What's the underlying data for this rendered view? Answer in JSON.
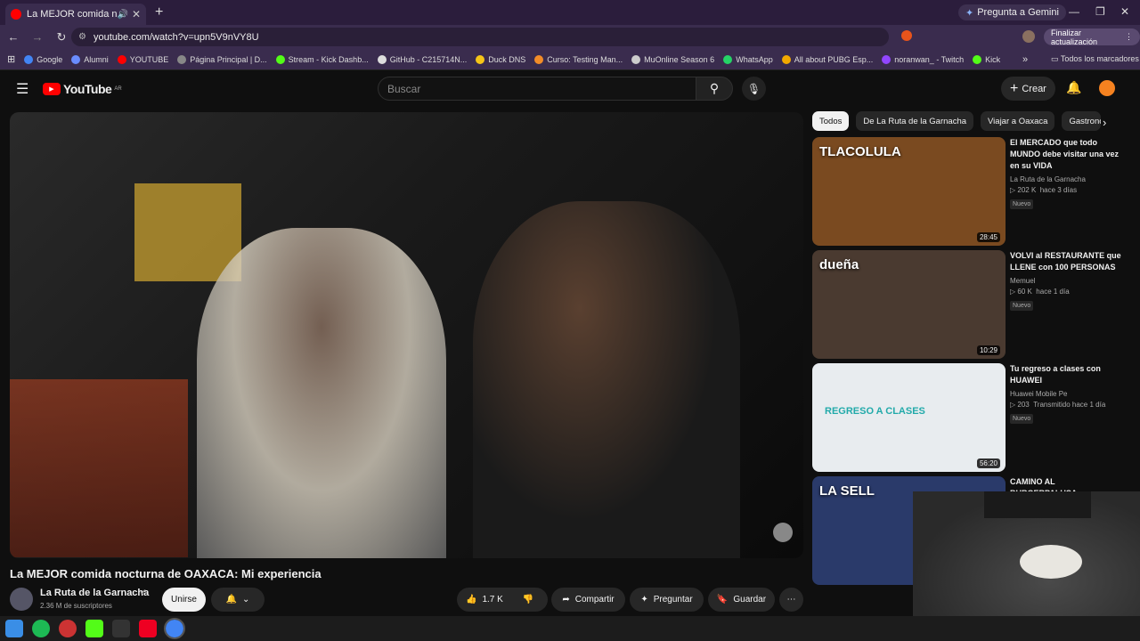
{
  "browser": {
    "tab_title": "La MEJOR comida nocturna",
    "gemini_label": "Pregunta a Gemini",
    "url": "youtube.com/watch?v=upn5V9nVY8U",
    "update_label": "Finalizar actualización",
    "bookmarks": [
      {
        "label": "Google",
        "color": "#4285f4"
      },
      {
        "label": "Alumni",
        "color": "#6a8cff"
      },
      {
        "label": "YOUTUBE",
        "color": "#ff0000"
      },
      {
        "label": "Página Principal | D...",
        "color": "#888888"
      },
      {
        "label": "Stream - Kick Dashb...",
        "color": "#53fc18"
      },
      {
        "label": "GitHub - C215714N...",
        "color": "#dddddd"
      },
      {
        "label": "Duck DNS",
        "color": "#f5c518"
      },
      {
        "label": "Curso: Testing Man...",
        "color": "#f28c28"
      },
      {
        "label": "MuOnline Season 6",
        "color": "#cccccc"
      },
      {
        "label": "WhatsApp",
        "color": "#25d366"
      },
      {
        "label": "All about PUBG Esp...",
        "color": "#f2a900"
      },
      {
        "label": "noranwan_ - Twitch",
        "color": "#9146ff"
      },
      {
        "label": "Kick",
        "color": "#53fc18"
      }
    ],
    "all_bookmarks": "Todos los marcadores"
  },
  "youtube": {
    "logo_text": "YouTube",
    "region": "AR",
    "search_placeholder": "Buscar",
    "create_label": "Crear",
    "video_title": "La MEJOR comida nocturna de OAXACA: Mi experiencia",
    "channel_name": "La Ruta de la Garnacha",
    "subscribers": "2.36 M de suscriptores",
    "join_label": "Unirse",
    "likes": "1.7 K",
    "share_label": "Compartir",
    "ask_label": "Preguntar",
    "save_label": "Guardar",
    "chips": [
      "Todos",
      "De La Ruta de la Garnacha",
      "Viajar a Oaxaca",
      "Gastrono"
    ],
    "recommendations": [
      {
        "title": "El MERCADO que todo MUNDO debe visitar una vez en su VIDA",
        "channel": "La Ruta de la Garnacha",
        "views": "202 K",
        "age": "hace 3 días",
        "badge": "Nuevo",
        "duration": "28:45",
        "thumb_text": "TLACOLULA",
        "thumb_color": "#7a4a20"
      },
      {
        "title": "VOLVI al RESTAURANTE que LLENE con 100 PERSONAS",
        "channel": "Memuel",
        "views": "60 K",
        "age": "hace 1 día",
        "badge": "Nuevo",
        "duration": "10:29",
        "thumb_text": "dueña",
        "thumb_color": "#4a3a30"
      },
      {
        "title": "Tu regreso a clases con HUAWEI",
        "channel": "Huawei Mobile Pe",
        "views": "203",
        "age": "Transmitido hace 1 día",
        "badge": "Nuevo",
        "duration": "56:20",
        "thumb_text": "REGRESO A CLASES",
        "thumb_color": "#e8ecef"
      },
      {
        "title": "CAMINO AL BURGERPALUSA:",
        "channel": "",
        "views": "",
        "age": "",
        "badge": "",
        "duration": "",
        "thumb_text": "LA SELL",
        "thumb_color": "#2a3a6a"
      }
    ]
  }
}
